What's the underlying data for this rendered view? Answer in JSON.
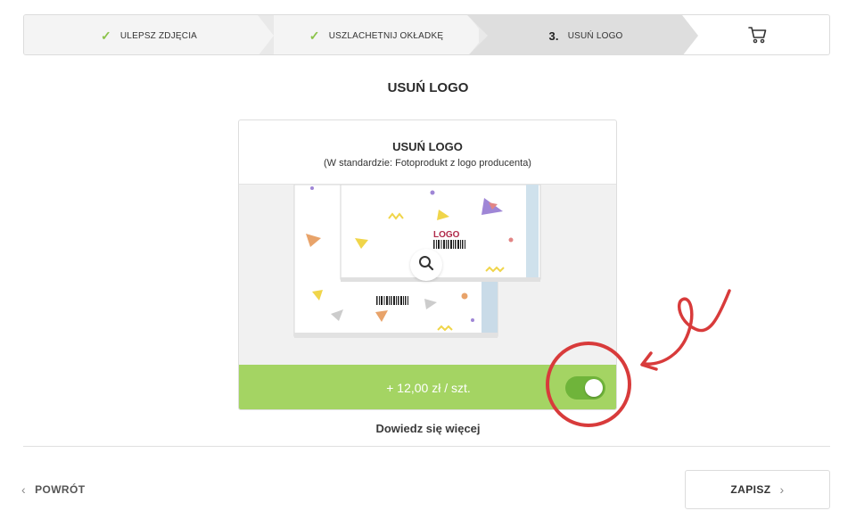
{
  "stepper": {
    "steps": [
      {
        "label": "ULEPSZ ZDJĘCIA",
        "status": "done",
        "icon": "check-icon"
      },
      {
        "label": "USZLACHETNIJ OKŁADKĘ",
        "status": "done",
        "icon": "check-icon"
      },
      {
        "number": "3.",
        "label": "USUŃ LOGO",
        "status": "current"
      },
      {
        "icon": "cart-icon",
        "status": "upcoming"
      }
    ]
  },
  "page": {
    "title": "USUŃ LOGO"
  },
  "option_card": {
    "title": "USUŃ LOGO",
    "subtitle": "(W standardzie: Fotoprodukt z logo producenta)",
    "image": {
      "logo_text": "LOGO",
      "zoom_icon": "magnifier-icon"
    },
    "price": "+ 12,00 zł / szt.",
    "toggle_enabled": true
  },
  "learn_more": "Dowiedz się więcej",
  "footer": {
    "back_label": "POWRÓT",
    "save_label": "ZAPISZ"
  },
  "colors": {
    "accent_green": "#a4d463",
    "toggle_green": "#6fb43a",
    "check_green": "#8bc34a",
    "annotation_red": "#d83b3b"
  }
}
